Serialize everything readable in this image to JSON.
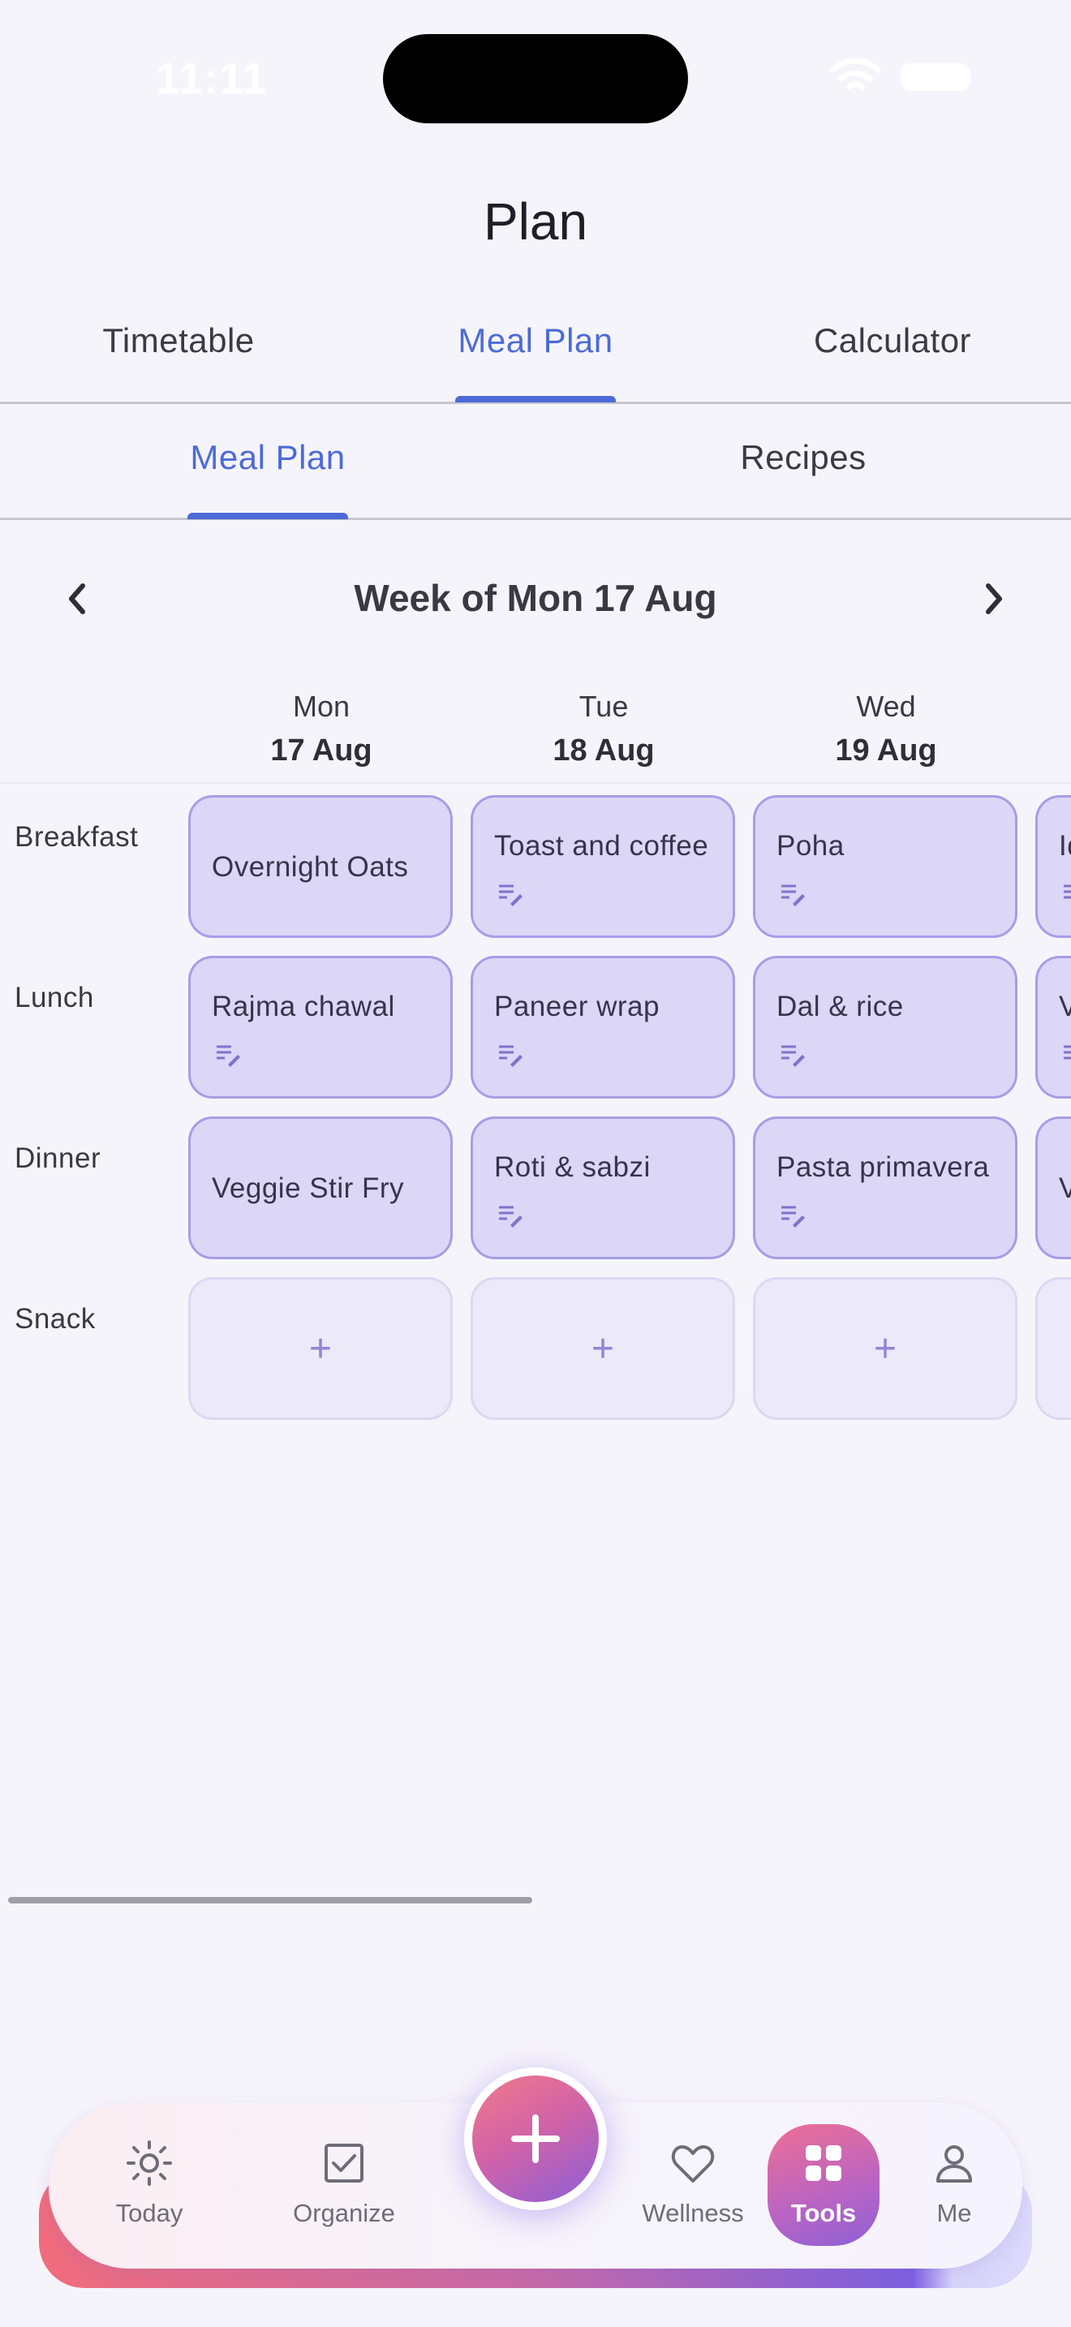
{
  "status_bar": {
    "time": "11:11"
  },
  "header": {
    "title": "Plan"
  },
  "top_tabs": [
    {
      "label": "Timetable",
      "active": false
    },
    {
      "label": "Meal Plan",
      "active": true
    },
    {
      "label": "Calculator",
      "active": false
    }
  ],
  "sub_tabs": [
    {
      "label": "Meal Plan",
      "active": true
    },
    {
      "label": "Recipes",
      "active": false
    }
  ],
  "week_nav": {
    "title": "Week of Mon 17 Aug",
    "prev_icon": "chevron-left-icon",
    "next_icon": "chevron-right-icon"
  },
  "days": [
    {
      "name": "Mon",
      "date": "17 Aug"
    },
    {
      "name": "Tue",
      "date": "18 Aug"
    },
    {
      "name": "Wed",
      "date": "19 Aug"
    }
  ],
  "meal_types": [
    "Breakfast",
    "Lunch",
    "Dinner",
    "Snack"
  ],
  "meals": {
    "breakfast": [
      {
        "text": "Overnight Oats",
        "has_note": false
      },
      {
        "text": "Toast and coffee",
        "has_note": true
      },
      {
        "text": "Poha",
        "has_note": true
      },
      {
        "text": "Id",
        "has_note": true
      }
    ],
    "lunch": [
      {
        "text": "Rajma chawal",
        "has_note": true
      },
      {
        "text": "Paneer wrap",
        "has_note": true
      },
      {
        "text": "Dal & rice",
        "has_note": true
      },
      {
        "text": "V",
        "has_note": true
      }
    ],
    "dinner": [
      {
        "text": "Veggie Stir Fry",
        "has_note": false
      },
      {
        "text": "Roti & sabzi",
        "has_note": true
      },
      {
        "text": "Pasta primavera",
        "has_note": true
      },
      {
        "text": "V",
        "has_note": false
      }
    ],
    "snack": [
      {
        "text": "+"
      },
      {
        "text": "+"
      },
      {
        "text": "+"
      },
      {
        "text": ""
      }
    ]
  },
  "bottom_nav": {
    "items": [
      {
        "label": "Today",
        "icon": "sun-icon"
      },
      {
        "label": "Organize",
        "icon": "checkbox-icon"
      },
      {
        "label": "Wellness",
        "icon": "heart-icon"
      },
      {
        "label": "Tools",
        "icon": "grid-icon",
        "active": true
      },
      {
        "label": "Me",
        "icon": "person-icon"
      }
    ],
    "fab_icon": "plus-icon"
  },
  "colors": {
    "accent": "#4c6bd6",
    "meal_cell_bg": "#dcd6f7",
    "meal_cell_border": "#a59ee6",
    "background": "#f6f4fb"
  }
}
